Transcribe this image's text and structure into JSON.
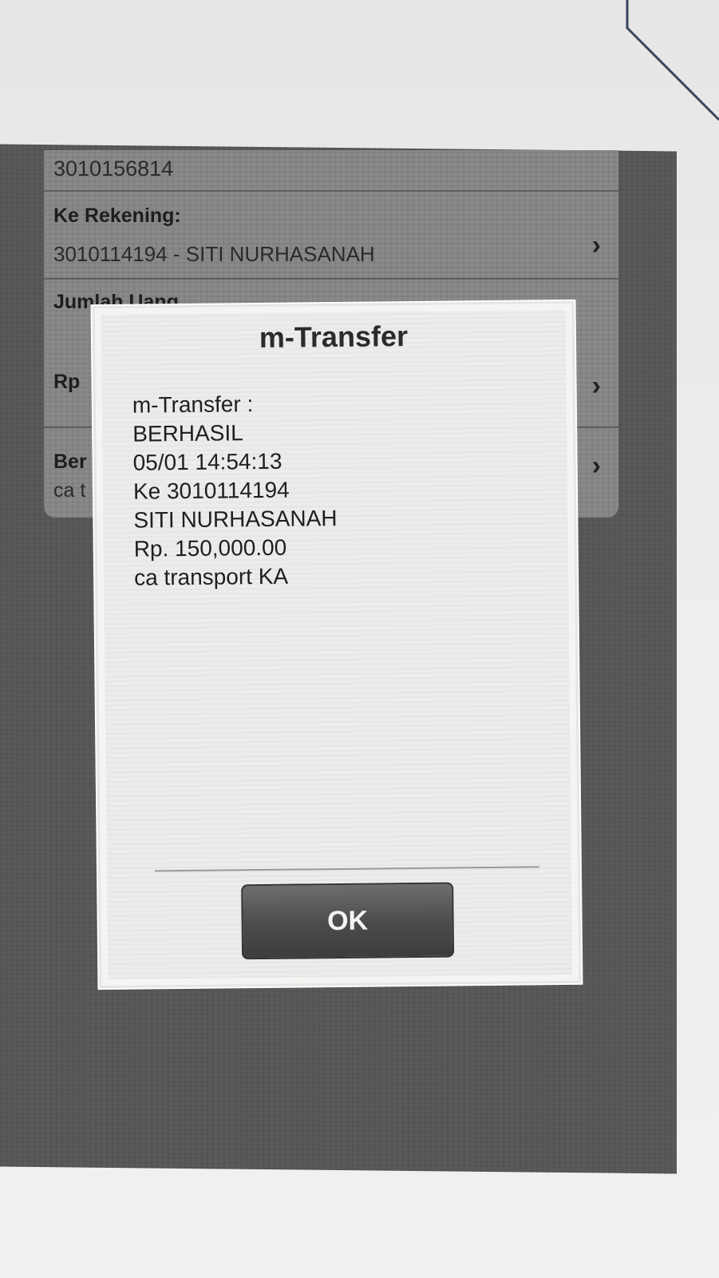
{
  "form": {
    "from_account": "3010156814",
    "to_label": "Ke Rekening:",
    "to_value": "3010114194 - SITI NURHASANAH",
    "amount_label": "Jumlah Uang",
    "currency_prefix": "Rp",
    "note_label_partial": "Ber",
    "note_value_partial": "ca t",
    "chevron_icon": "chevron-right-icon"
  },
  "dialog": {
    "title": "m-Transfer",
    "lines": [
      "m-Transfer :",
      "BERHASIL",
      "05/01 14:54:13",
      "Ke 3010114194",
      "SITI NURHASANAH",
      "Rp. 150,000.00",
      "ca transport KA"
    ],
    "ok_label": "OK"
  }
}
